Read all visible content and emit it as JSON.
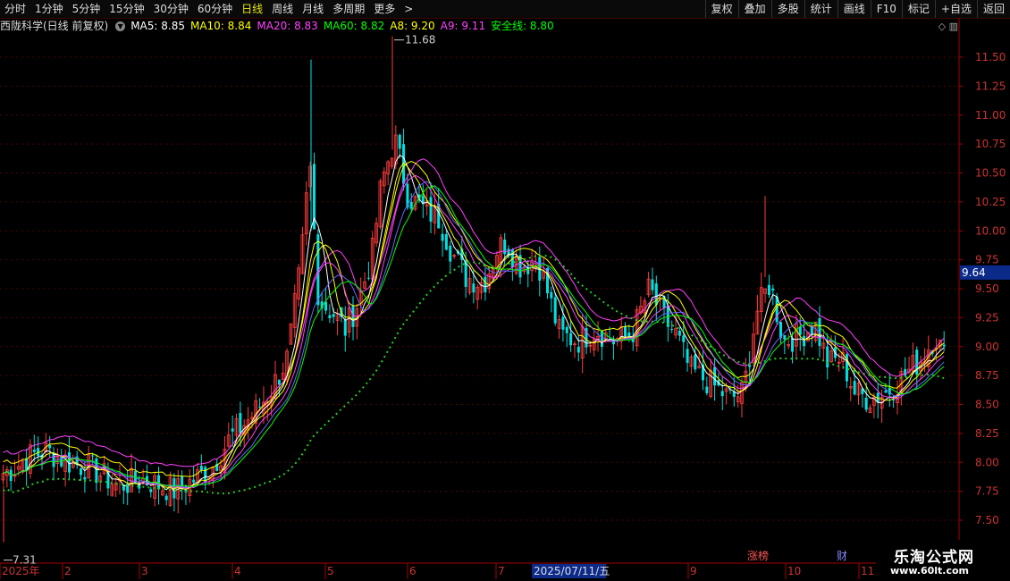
{
  "toolbar": {
    "periods": [
      "分时",
      "1分钟",
      "5分钟",
      "15分钟",
      "30分钟",
      "60分钟",
      "日线",
      "周线",
      "月线",
      "多周期",
      "更多"
    ],
    "active_period": "日线",
    "tools": [
      "复权",
      "叠加",
      "多股",
      "统计",
      "画线",
      "F10",
      "标记",
      "+自选",
      "返回"
    ]
  },
  "legend": {
    "title": "西陇科学(日线 前复权)",
    "ma5": "MA5: 8.85",
    "ma10": "MA10: 8.84",
    "ma20": "MA20: 8.83",
    "ma60": "MA60: 8.82",
    "a8": "A8: 9.20",
    "a9": "A9: 9.11",
    "safe": "安全线: 8.80"
  },
  "colors": {
    "up": "#ff3c3c",
    "down": "#00e0e0",
    "ma5": "#ffffff",
    "ma10": "#ffff00",
    "ma20": "#ff40ff",
    "ma60": "#00ff00",
    "safe": "#22cc22",
    "axis": "#aa0000",
    "grid": "#550000"
  },
  "price_axis": {
    "labels": [
      "11.50",
      "11.25",
      "11.00",
      "10.75",
      "10.50",
      "10.25",
      "10.00",
      "9.75",
      "9.50",
      "9.25",
      "9.00",
      "8.75",
      "8.50",
      "8.25",
      "8.00",
      "7.75",
      "7.50"
    ],
    "current_price": "9.64"
  },
  "annotations": {
    "high": "11.68",
    "low": "7.31"
  },
  "time_axis": {
    "labels": [
      "2025年",
      "2",
      "3",
      "4",
      "5",
      "6",
      "7",
      "9",
      "10",
      "11"
    ],
    "cursor_date": "2025/07/11/五"
  },
  "markers": {
    "zhang_bang": "涨榜",
    "cai": "财"
  },
  "watermark": {
    "title": "乐淘公式网",
    "url": "www.60lt.com"
  },
  "chart_data": {
    "type": "candlestick",
    "symbol": "西陇科学",
    "period": "日线 前复权",
    "y_range": [
      7.31,
      11.68
    ],
    "key_points": [
      {
        "date": "2025-01",
        "close": 7.9
      },
      {
        "date": "2025-02",
        "close": 8.0
      },
      {
        "date": "2025-03",
        "close": 7.75
      },
      {
        "date": "2025-04",
        "close": 8.3
      },
      {
        "date": "2025-05",
        "close": 9.5
      },
      {
        "date": "2025-06",
        "close": 10.4
      },
      {
        "date": "2025-07",
        "close": 9.6
      },
      {
        "date": "2025-08",
        "close": 9.3
      },
      {
        "date": "2025-09",
        "close": 8.6
      },
      {
        "date": "2025-10",
        "close": 9.0
      },
      {
        "date": "2025-11",
        "close": 8.85
      }
    ],
    "high": 11.68,
    "low": 7.31,
    "last": {
      "ma5": 8.85,
      "ma10": 8.84,
      "ma20": 8.83,
      "ma60": 8.82,
      "a8": 9.2,
      "a9": 9.11,
      "safe_line": 8.8
    }
  }
}
